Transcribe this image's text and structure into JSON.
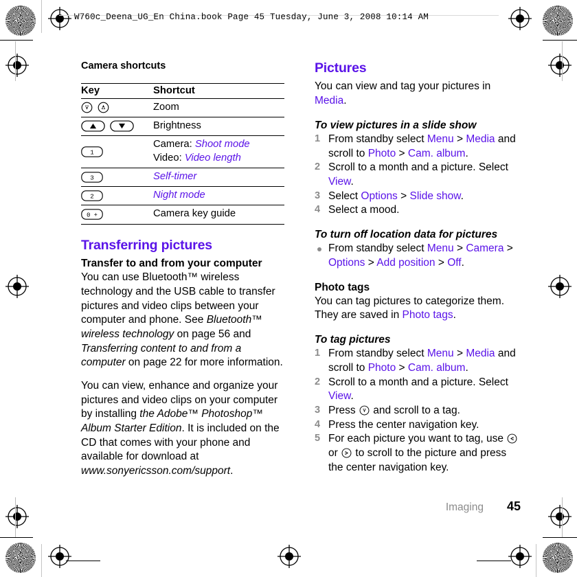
{
  "header": {
    "line": "W760c_Deena_UG_En China.book  Page 45  Tuesday, June 3, 2008  10:14 AM"
  },
  "footer": {
    "chapter": "Imaging",
    "page_number": "45"
  },
  "colors": {
    "accent": "#5a13e8",
    "muted": "#8b8b8b",
    "text": "#000000"
  },
  "left_column": {
    "table_title": "Camera shortcuts",
    "table": {
      "columns": [
        "Key",
        "Shortcut"
      ],
      "rows": [
        {
          "key_icons": [
            "volume-down-key-icon",
            "volume-up-key-icon"
          ],
          "key_labels": [
            "",
            ""
          ],
          "shortcut_parts": [
            {
              "text": "Zoom",
              "style": "plain"
            }
          ]
        },
        {
          "key_icons": [
            "brightness-up-key-icon",
            "brightness-down-key-icon"
          ],
          "key_labels": [
            "",
            ""
          ],
          "shortcut_parts": [
            {
              "text": "Brightness",
              "style": "plain"
            }
          ]
        },
        {
          "key_icons": [
            "numeric-key-icon"
          ],
          "key_labels": [
            "1"
          ],
          "shortcut_parts": [
            {
              "text": "Camera: ",
              "style": "plain"
            },
            {
              "text": "Shoot mode",
              "style": "link-italic"
            },
            {
              "text": "\n",
              "style": "break"
            },
            {
              "text": "Video: ",
              "style": "plain"
            },
            {
              "text": "Video length",
              "style": "link-italic"
            }
          ]
        },
        {
          "key_icons": [
            "numeric-key-icon"
          ],
          "key_labels": [
            "3"
          ],
          "shortcut_parts": [
            {
              "text": "Self-timer",
              "style": "link-italic"
            }
          ]
        },
        {
          "key_icons": [
            "numeric-key-icon"
          ],
          "key_labels": [
            "2"
          ],
          "shortcut_parts": [
            {
              "text": "Night mode",
              "style": "link-italic"
            }
          ]
        },
        {
          "key_icons": [
            "numeric-key-icon"
          ],
          "key_labels": [
            "0 +"
          ],
          "shortcut_parts": [
            {
              "text": "Camera key guide",
              "style": "plain"
            }
          ]
        }
      ]
    },
    "section_heading": "Transferring pictures",
    "subheading": "Transfer to and from your computer",
    "paragraph_1": {
      "t1": "You can use Bluetooth™ wireless technology and the USB cable to transfer pictures and video clips between your computer and phone. See ",
      "i1": "Bluetooth™ wireless technology",
      "t2": " on page 56 and ",
      "i2": "Transferring content to and from a computer",
      "t3": " on page 22 for more information."
    },
    "paragraph_2": {
      "t1": "You can view, enhance and organize your pictures and video clips on your computer by installing ",
      "i1": "the Adobe™ Photoshop™ Album Starter Edition",
      "t2": ". It is included on the CD that comes with your phone and available for download at ",
      "i2": "www.sonyericsson.com/support",
      "t3": "."
    }
  },
  "right_column": {
    "section_heading": "Pictures",
    "intro": {
      "t1": "You can view and tag your pictures in ",
      "l1": "Media",
      "t2": "."
    },
    "slide_show": {
      "heading": "To view pictures in a slide show",
      "steps": [
        {
          "parts": [
            {
              "text": "From standby select ",
              "style": "plain"
            },
            {
              "text": "Menu",
              "style": "link"
            },
            {
              "text": " > ",
              "style": "plain"
            },
            {
              "text": "Media",
              "style": "link"
            },
            {
              "text": " and scroll to ",
              "style": "plain"
            },
            {
              "text": "Photo",
              "style": "link"
            },
            {
              "text": " > ",
              "style": "plain"
            },
            {
              "text": "Cam. album",
              "style": "link"
            },
            {
              "text": ".",
              "style": "plain"
            }
          ]
        },
        {
          "parts": [
            {
              "text": "Scroll to a month and a picture. Select ",
              "style": "plain"
            },
            {
              "text": "View",
              "style": "link"
            },
            {
              "text": ".",
              "style": "plain"
            }
          ]
        },
        {
          "parts": [
            {
              "text": "Select ",
              "style": "plain"
            },
            {
              "text": "Options",
              "style": "link"
            },
            {
              "text": " > ",
              "style": "plain"
            },
            {
              "text": "Slide show",
              "style": "link"
            },
            {
              "text": ".",
              "style": "plain"
            }
          ]
        },
        {
          "parts": [
            {
              "text": "Select a mood.",
              "style": "plain"
            }
          ]
        }
      ]
    },
    "location_data": {
      "heading": "To turn off location data for pictures",
      "bullets": [
        {
          "parts": [
            {
              "text": "From standby select ",
              "style": "plain"
            },
            {
              "text": "Menu",
              "style": "link"
            },
            {
              "text": " > ",
              "style": "plain"
            },
            {
              "text": "Camera",
              "style": "link"
            },
            {
              "text": " > ",
              "style": "plain"
            },
            {
              "text": "Options",
              "style": "link"
            },
            {
              "text": " > ",
              "style": "plain"
            },
            {
              "text": "Add position",
              "style": "link"
            },
            {
              "text": " > ",
              "style": "plain"
            },
            {
              "text": "Off",
              "style": "link"
            },
            {
              "text": ".",
              "style": "plain"
            }
          ]
        }
      ]
    },
    "photo_tags": {
      "heading": "Photo tags",
      "body": {
        "t1": "You can tag pictures to categorize them. They are saved in ",
        "l1": "Photo tags",
        "t2": "."
      }
    },
    "tag_pictures": {
      "heading": "To tag pictures",
      "steps": [
        {
          "parts": [
            {
              "text": "From standby select ",
              "style": "plain"
            },
            {
              "text": "Menu",
              "style": "link"
            },
            {
              "text": " > ",
              "style": "plain"
            },
            {
              "text": "Media",
              "style": "link"
            },
            {
              "text": " and scroll to ",
              "style": "plain"
            },
            {
              "text": "Photo",
              "style": "link"
            },
            {
              "text": " > ",
              "style": "plain"
            },
            {
              "text": "Cam. album",
              "style": "link"
            },
            {
              "text": ".",
              "style": "plain"
            }
          ]
        },
        {
          "parts": [
            {
              "text": "Scroll to a month and a picture. Select ",
              "style": "plain"
            },
            {
              "text": "View",
              "style": "link"
            },
            {
              "text": ".",
              "style": "plain"
            }
          ]
        },
        {
          "parts": [
            {
              "text": "Press ",
              "style": "plain"
            },
            {
              "text": "",
              "style": "icon-volume-down"
            },
            {
              "text": " and scroll to a tag.",
              "style": "plain"
            }
          ]
        },
        {
          "parts": [
            {
              "text": "Press the center navigation key.",
              "style": "plain"
            }
          ]
        },
        {
          "parts": [
            {
              "text": "For each picture you want to tag, use ",
              "style": "plain"
            },
            {
              "text": "",
              "style": "icon-nav-left"
            },
            {
              "text": " or ",
              "style": "plain"
            },
            {
              "text": "",
              "style": "icon-nav-right"
            },
            {
              "text": " to scroll to the picture and press the center navigation key.",
              "style": "plain"
            }
          ]
        }
      ]
    }
  }
}
